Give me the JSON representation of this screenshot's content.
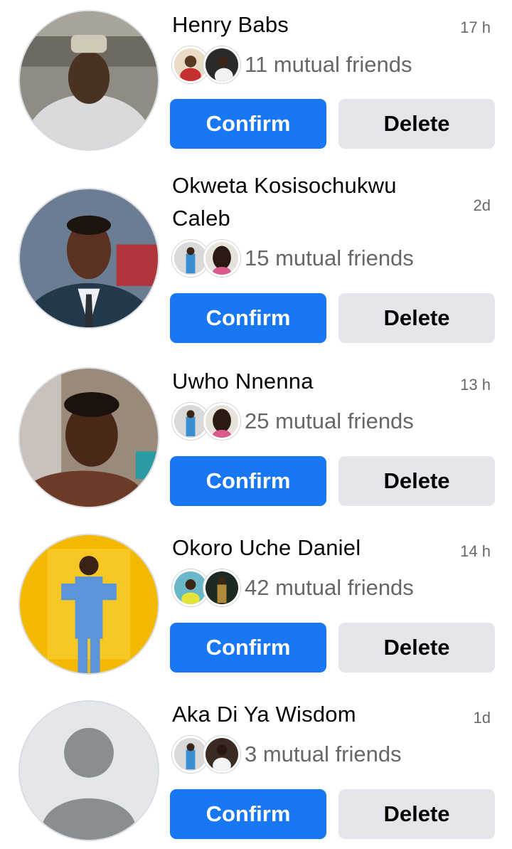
{
  "requests": [
    {
      "name": "Henry Babs",
      "time": "17 h",
      "mutual": "11 mutual friends",
      "confirm": "Confirm",
      "delete": "Delete"
    },
    {
      "name": "Okweta Kosisochukwu Caleb",
      "time": "2d",
      "mutual": "15 mutual friends",
      "confirm": "Confirm",
      "delete": "Delete"
    },
    {
      "name": "Uwho Nnenna",
      "time": "13 h",
      "mutual": "25 mutual friends",
      "confirm": "Confirm",
      "delete": "Delete"
    },
    {
      "name": "Okoro Uche Daniel",
      "time": "14 h",
      "mutual": "42 mutual friends",
      "confirm": "Confirm",
      "delete": "Delete"
    },
    {
      "name": "Aka Di Ya Wisdom",
      "time": "1d",
      "mutual": "3 mutual friends",
      "confirm": "Confirm",
      "delete": "Delete"
    }
  ],
  "colors": {
    "confirm_bg": "#1877f2",
    "delete_bg": "#e4e6eb",
    "secondary_text": "#65676b"
  }
}
